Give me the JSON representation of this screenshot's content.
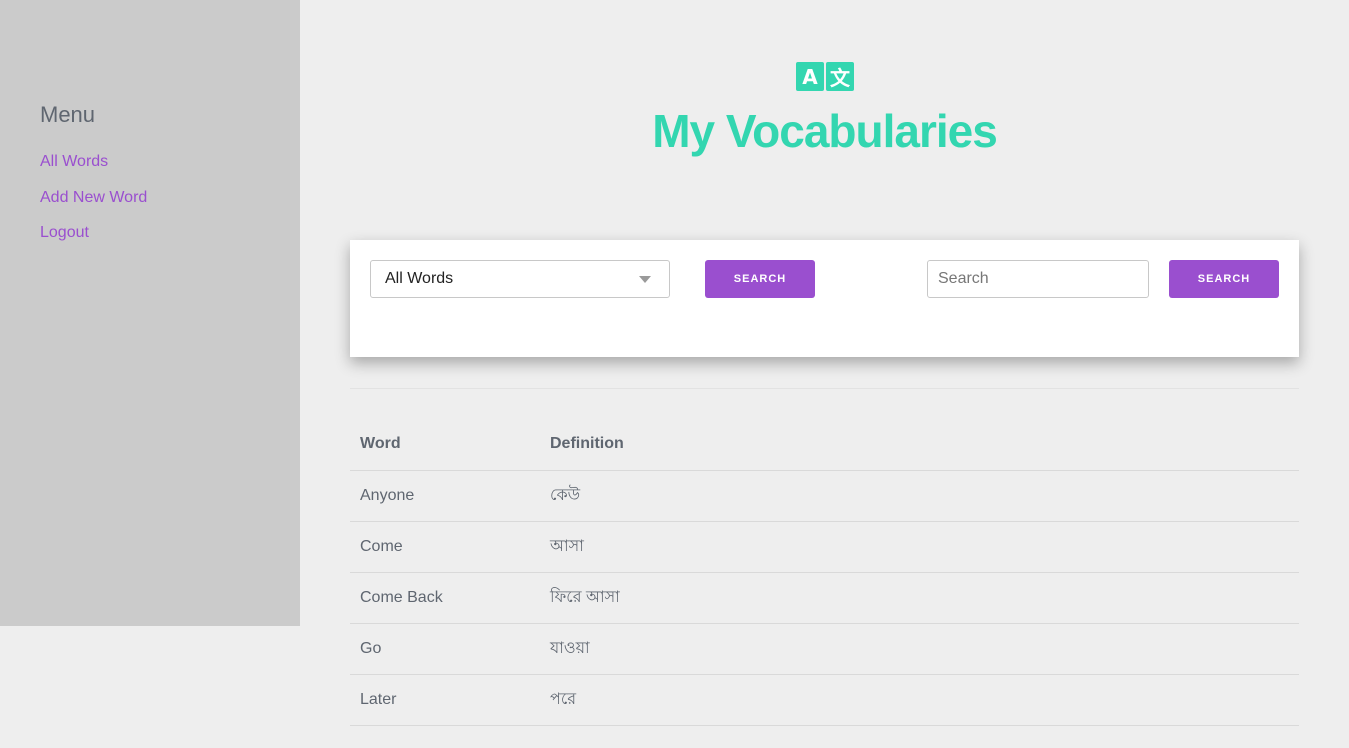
{
  "sidebar": {
    "title": "Menu",
    "items": [
      {
        "label": "All Words"
      },
      {
        "label": "Add New Word"
      },
      {
        "label": "Logout"
      }
    ]
  },
  "header": {
    "logo_left": "A",
    "logo_right": "文",
    "title": "My Vocabularies"
  },
  "filter": {
    "selected": "All Words",
    "button_label": "SEARCH"
  },
  "search": {
    "placeholder": "Search",
    "button_label": "SEARCH"
  },
  "table": {
    "columns": [
      "Word",
      "Definition"
    ],
    "rows": [
      {
        "word": "Anyone",
        "definition": "কেউ"
      },
      {
        "word": "Come",
        "definition": "আসা"
      },
      {
        "word": "Come Back",
        "definition": "ফিরে আসা"
      },
      {
        "word": "Go",
        "definition": "যাওয়া"
      },
      {
        "word": "Later",
        "definition": "পরে"
      }
    ]
  },
  "colors": {
    "accent": "#9a4fcf",
    "brand": "#33d6b0",
    "sidebar_bg": "#cbcbcb",
    "page_bg": "#eeeeee"
  }
}
